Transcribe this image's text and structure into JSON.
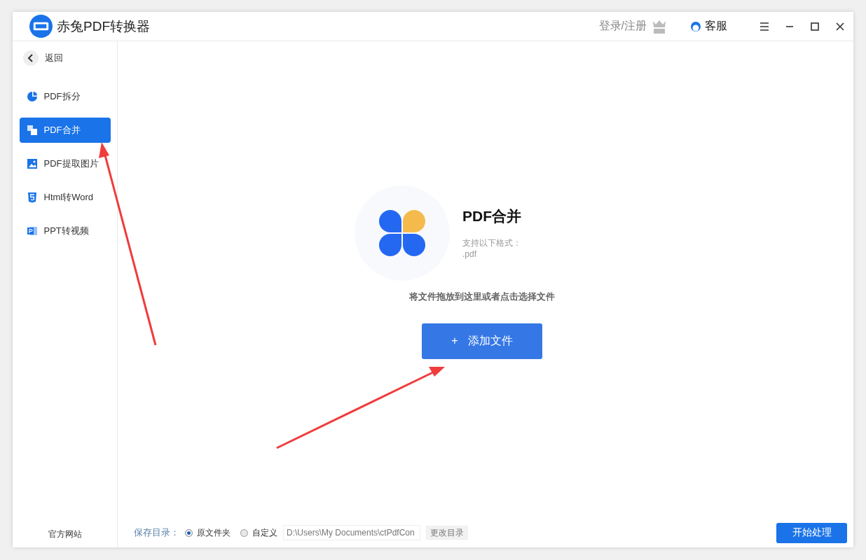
{
  "window": {
    "title": "赤兔PDF转换器",
    "login": "登录/注册",
    "service": "客服"
  },
  "sidebar": {
    "back": "返回",
    "items": [
      {
        "kind": "pie",
        "label": "PDF拆分",
        "selected": false
      },
      {
        "kind": "merge",
        "label": "PDF合并",
        "selected": true
      },
      {
        "kind": "image",
        "label": "PDF提取图片",
        "selected": false
      },
      {
        "kind": "html",
        "label": "Html转Word",
        "selected": false
      },
      {
        "kind": "ppt",
        "label": "PPT转视频",
        "selected": false
      }
    ],
    "footer": "官方网站"
  },
  "tool": {
    "title": "PDF合并",
    "formats_label": "支持以下格式：",
    "formats": ".pdf",
    "hint": "将文件拖放到这里或者点击选择文件",
    "add_button": "添加文件",
    "add_icon": "+"
  },
  "save": {
    "label": "保存目录：",
    "options": [
      {
        "label": "原文件夹",
        "selected": true
      },
      {
        "label": "自定义",
        "selected": false
      }
    ],
    "path": "D:\\Users\\My Documents\\ctPdfCon",
    "change_button": "更改目录"
  },
  "start_button": "开始处理"
}
